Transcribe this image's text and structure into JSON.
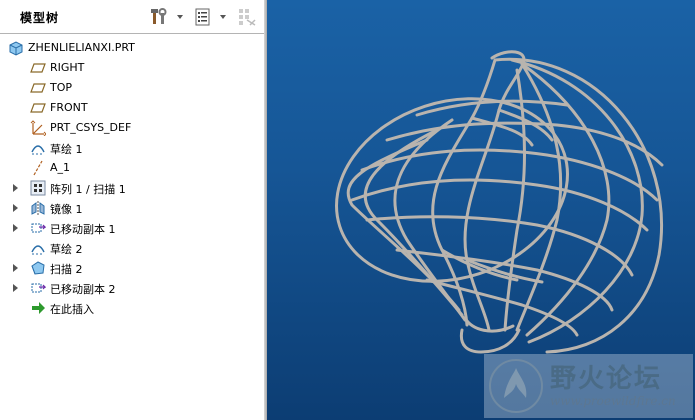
{
  "panel": {
    "title": "模型树",
    "toolbar": [
      {
        "name": "settings-icon"
      },
      {
        "name": "tree-filter-icon"
      },
      {
        "name": "display-options-icon"
      }
    ]
  },
  "tree": {
    "root": {
      "label": "ZHENLIELIANXI.PRT",
      "icon": "part-icon"
    },
    "items": [
      {
        "label": "RIGHT",
        "icon": "datum-plane-icon",
        "expandable": false
      },
      {
        "label": "TOP",
        "icon": "datum-plane-icon",
        "expandable": false
      },
      {
        "label": "FRONT",
        "icon": "datum-plane-icon",
        "expandable": false
      },
      {
        "label": "PRT_CSYS_DEF",
        "icon": "coordinate-system-icon",
        "expandable": false
      },
      {
        "label": "草绘 1",
        "icon": "sketch-icon",
        "expandable": false
      },
      {
        "label": "A_1",
        "icon": "datum-axis-icon",
        "expandable": false
      },
      {
        "label": "阵列 1 / 扫描 1",
        "icon": "pattern-icon",
        "expandable": true
      },
      {
        "label": "镜像 1",
        "icon": "mirror-icon",
        "expandable": true
      },
      {
        "label": "已移动副本 1",
        "icon": "moved-copy-icon",
        "expandable": true
      },
      {
        "label": "草绘 2",
        "icon": "sketch-icon",
        "expandable": false
      },
      {
        "label": "扫描 2",
        "icon": "sweep-icon",
        "expandable": true
      },
      {
        "label": "已移动副本 2",
        "icon": "moved-copy-icon",
        "expandable": true
      },
      {
        "label": "在此插入",
        "icon": "insert-here-icon",
        "expandable": false
      }
    ]
  },
  "watermark": {
    "title": "野火论坛",
    "url": "www.proewildfire.cn"
  },
  "colors": {
    "viewport_top": "#1a62a6",
    "viewport_bottom": "#0c3d73",
    "wireframe": "#b9b4ae",
    "insert_arrow": "#2e9a2e"
  }
}
